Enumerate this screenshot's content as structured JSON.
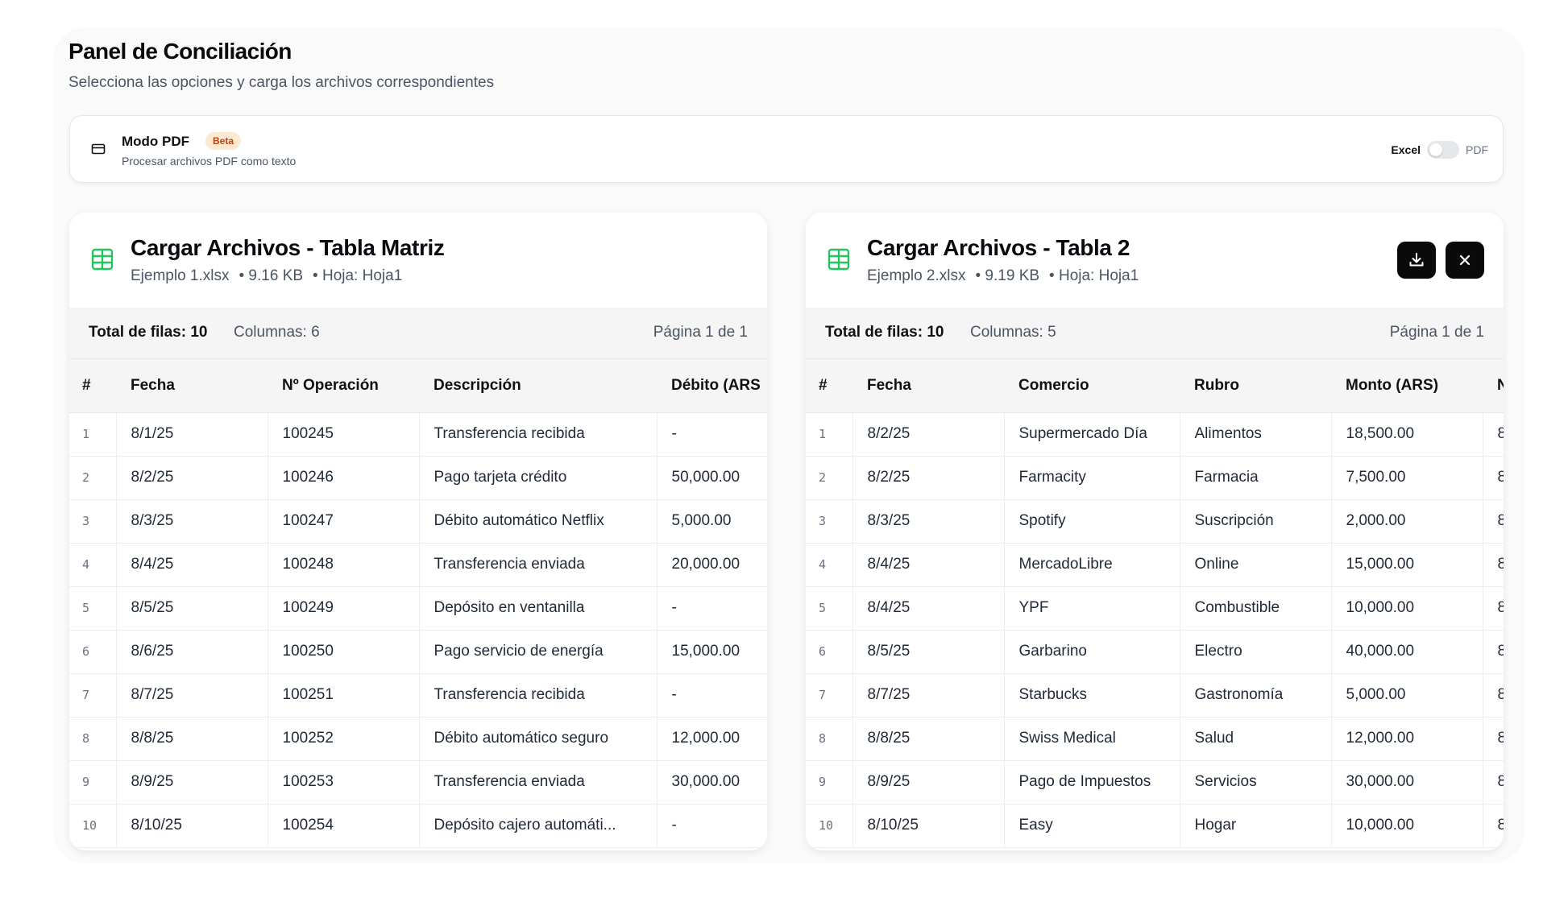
{
  "page": {
    "title": "Panel de Conciliación",
    "subtitle": "Selecciona las opciones y carga los archivos correspondientes"
  },
  "mode": {
    "title": "Modo PDF",
    "badge": "Beta",
    "description": "Procesar archivos PDF como texto",
    "toggle_left": "Excel",
    "toggle_right": "PDF",
    "selected": "Excel"
  },
  "tables": [
    {
      "title": "Cargar Archivos - Tabla Matriz",
      "file_name": "Ejemplo 1.xlsx",
      "file_size": "• 9.16 KB",
      "sheet": "• Hoja: Hoja1",
      "total_rows": "Total de filas: 10",
      "columns": "Columnas: 6",
      "page": "Página 1 de 1",
      "headers": [
        "#",
        "Fecha",
        "Nº Operación",
        "Descripción",
        "Débito (ARS"
      ],
      "rows": [
        [
          "1",
          "8/1/25",
          "100245",
          "Transferencia recibida",
          "-"
        ],
        [
          "2",
          "8/2/25",
          "100246",
          "Pago tarjeta crédito",
          "50,000.00"
        ],
        [
          "3",
          "8/3/25",
          "100247",
          "Débito automático Netflix",
          "5,000.00"
        ],
        [
          "4",
          "8/4/25",
          "100248",
          "Transferencia enviada",
          "20,000.00"
        ],
        [
          "5",
          "8/5/25",
          "100249",
          "Depósito en ventanilla",
          "-"
        ],
        [
          "6",
          "8/6/25",
          "100250",
          "Pago servicio de energía",
          "15,000.00"
        ],
        [
          "7",
          "8/7/25",
          "100251",
          "Transferencia recibida",
          "-"
        ],
        [
          "8",
          "8/8/25",
          "100252",
          "Débito automático seguro",
          "12,000.00"
        ],
        [
          "9",
          "8/9/25",
          "100253",
          "Transferencia enviada",
          "30,000.00"
        ],
        [
          "10",
          "8/10/25",
          "100254",
          "Depósito cajero automáti...",
          "-"
        ]
      ]
    },
    {
      "title": "Cargar Archivos - Tabla 2",
      "file_name": "Ejemplo 2.xlsx",
      "file_size": "• 9.19 KB",
      "sheet": "• Hoja: Hoja1",
      "total_rows": "Total de filas: 10",
      "columns": "Columnas: 5",
      "page": "Página 1 de 1",
      "headers": [
        "#",
        "Fecha",
        "Comercio",
        "Rubro",
        "Monto (ARS)",
        "N"
      ],
      "rows": [
        [
          "1",
          "8/2/25",
          "Supermercado Día",
          "Alimentos",
          "18,500.00",
          "8"
        ],
        [
          "2",
          "8/2/25",
          "Farmacity",
          "Farmacia",
          "7,500.00",
          "8"
        ],
        [
          "3",
          "8/3/25",
          "Spotify",
          "Suscripción",
          "2,000.00",
          "8"
        ],
        [
          "4",
          "8/4/25",
          "MercadoLibre",
          "Online",
          "15,000.00",
          "8"
        ],
        [
          "5",
          "8/4/25",
          "YPF",
          "Combustible",
          "10,000.00",
          "8"
        ],
        [
          "6",
          "8/5/25",
          "Garbarino",
          "Electro",
          "40,000.00",
          "8"
        ],
        [
          "7",
          "8/7/25",
          "Starbucks",
          "Gastronomía",
          "5,000.00",
          "8"
        ],
        [
          "8",
          "8/8/25",
          "Swiss Medical",
          "Salud",
          "12,000.00",
          "8"
        ],
        [
          "9",
          "8/9/25",
          "Pago de Impuestos",
          "Servicios",
          "30,000.00",
          "8"
        ],
        [
          "10",
          "8/10/25",
          "Easy",
          "Hogar",
          "10,000.00",
          "8"
        ]
      ]
    }
  ],
  "icons": {
    "sheet_icon_color": "#22c55e",
    "mode_icon": "card-icon",
    "download_icon": "download-icon",
    "close_icon": "close-icon"
  }
}
